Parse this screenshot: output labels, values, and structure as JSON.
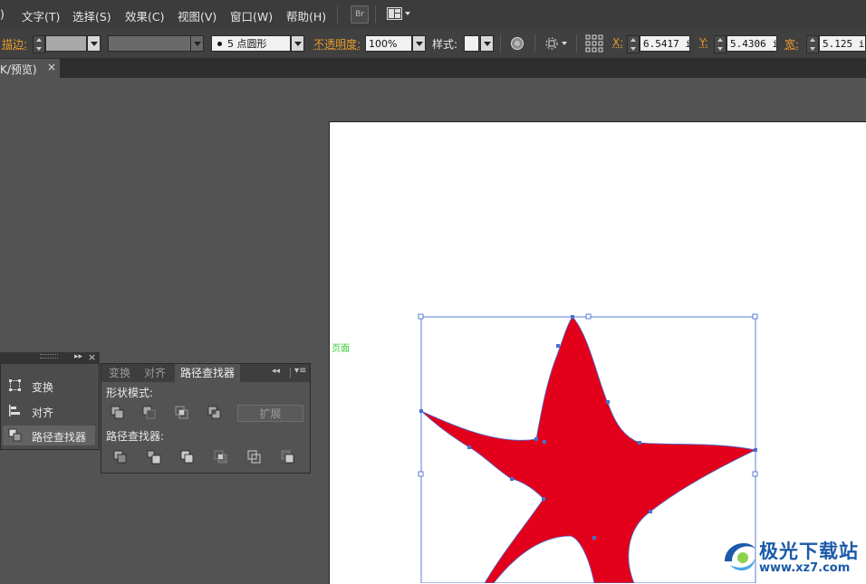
{
  "menu": {
    "partial_first": ")",
    "items": [
      "文字(T)",
      "选择(S)",
      "效果(C)",
      "视图(V)",
      "窗口(W)",
      "帮助(H)"
    ],
    "bridge_label": "Br"
  },
  "control_bar": {
    "stroke_label": "描边:",
    "brush_size": "5",
    "brush_label": "点圆形",
    "opacity_label": "不透明度:",
    "opacity_value": "100%",
    "style_label": "样式:",
    "x_label": "X:",
    "x_value": "6.5417 i:",
    "y_label": "Y:",
    "y_value": "5.4306 i:",
    "w_label": "宽:",
    "w_value": "5.125 in"
  },
  "document_tab": {
    "title": "K/预览)",
    "close": "×"
  },
  "artboard": {
    "page_label": "页面",
    "shape_color": "#e3001b"
  },
  "icon_panel": {
    "items": [
      {
        "label": "变换",
        "icon": "transform-icon"
      },
      {
        "label": "对齐",
        "icon": "align-icon"
      },
      {
        "label": "路径查找器",
        "icon": "pathfinder-icon"
      }
    ]
  },
  "pathfinder_panel": {
    "tabs": [
      "变换",
      "对齐",
      "路径查找器"
    ],
    "shape_modes_label": "形状模式:",
    "expand_label": "扩展",
    "pathfinders_label": "路径查找器:"
  },
  "watermark": {
    "text": "极光下载站",
    "url": "www.xz7.com"
  },
  "colors": {
    "accent_orange": "#e79a2d",
    "selection_blue": "#4a6fd1",
    "star_red": "#e3001b"
  }
}
